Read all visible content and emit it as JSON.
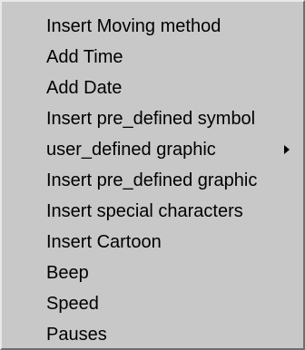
{
  "context_menu": {
    "items": [
      {
        "label": "Insert Moving method",
        "has_submenu": false
      },
      {
        "label": "Add Time",
        "has_submenu": false
      },
      {
        "label": "Add Date",
        "has_submenu": false
      },
      {
        "label": "Insert pre_defined symbol",
        "has_submenu": false
      },
      {
        "label": "user_defined graphic",
        "has_submenu": true,
        "submenu_icon": "chevron-right-icon"
      },
      {
        "label": "Insert pre_defined graphic",
        "has_submenu": false
      },
      {
        "label": "Insert special characters",
        "has_submenu": false
      },
      {
        "label": "Insert Cartoon",
        "has_submenu": false
      },
      {
        "label": "Beep",
        "has_submenu": false
      },
      {
        "label": "Speed",
        "has_submenu": false
      },
      {
        "label": "Pauses",
        "has_submenu": false
      }
    ]
  }
}
